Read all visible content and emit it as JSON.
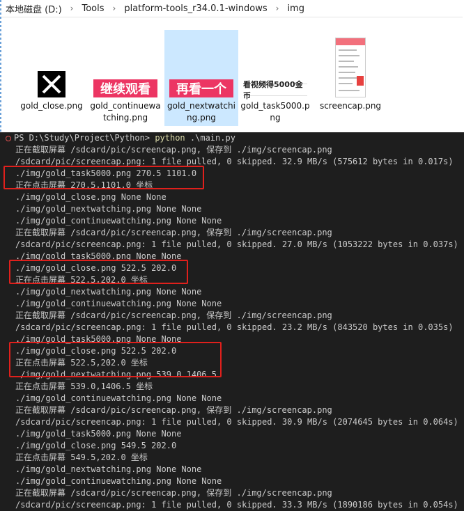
{
  "explorer": {
    "breadcrumb": [
      "本地磁盘 (D:)",
      "Tools",
      "platform-tools_r34.0.1-windows",
      "img"
    ],
    "separator": "›",
    "files": [
      {
        "name": "gold_close.png",
        "thumb": "close-x-icon"
      },
      {
        "name": "gold_continuewatching.png",
        "thumb": "banner",
        "banner_text": "继续观看"
      },
      {
        "name": "gold_nextwatching.png",
        "thumb": "banner",
        "banner_text": "再看一个"
      },
      {
        "name": "gold_task5000.png",
        "thumb": "banner",
        "banner_text": "看视频得5000金币"
      },
      {
        "name": "screencap.png",
        "thumb": "phone-screenshot"
      }
    ],
    "selected_file": "gold_nextwatching.png"
  },
  "terminal": {
    "prompt": "PS D:\\Study\\Project\\Python>",
    "command": "python",
    "command_args": ".\\main.py",
    "lines": [
      "正在截取屏幕 /sdcard/pic/screencap.png, 保存到 ./img/screencap.png",
      "/sdcard/pic/screencap.png: 1 file pulled, 0 skipped. 32.9 MB/s (575612 bytes in 0.017s)",
      "./img/gold_task5000.png 270.5 1101.0",
      "正在点击屏幕 270.5,1101.0 坐标",
      "./img/gold_close.png None None",
      "./img/gold_nextwatching.png None None",
      "./img/gold_continuewatching.png None None",
      "正在截取屏幕 /sdcard/pic/screencap.png, 保存到 ./img/screencap.png",
      "/sdcard/pic/screencap.png: 1 file pulled, 0 skipped. 27.0 MB/s (1053222 bytes in 0.037s)",
      "./img/gold_task5000.png None None",
      "./img/gold_close.png 522.5 202.0",
      "正在点击屏幕 522.5,202.0 坐标",
      "./img/gold_nextwatching.png None None",
      "./img/gold_continuewatching.png None None",
      "正在截取屏幕 /sdcard/pic/screencap.png, 保存到 ./img/screencap.png",
      "/sdcard/pic/screencap.png: 1 file pulled, 0 skipped. 23.2 MB/s (843520 bytes in 0.035s)",
      "./img/gold_task5000.png None None",
      "./img/gold_close.png 522.5 202.0",
      "正在点击屏幕 522.5,202.0 坐标",
      "./img/gold_nextwatching.png 539.0 1406.5",
      "正在点击屏幕 539.0,1406.5 坐标",
      "./img/gold_continuewatching.png None None",
      "正在截取屏幕 /sdcard/pic/screencap.png, 保存到 ./img/screencap.png",
      "/sdcard/pic/screencap.png: 1 file pulled, 0 skipped. 30.9 MB/s (2074645 bytes in 0.064s)",
      "./img/gold_task5000.png None None",
      "./img/gold_close.png 549.5 202.0",
      "正在点击屏幕 549.5,202.0 坐标",
      "./img/gold_nextwatching.png None None",
      "./img/gold_continuewatching.png None None",
      "正在截取屏幕 /sdcard/pic/screencap.png, 保存到 ./img/screencap.png",
      "/sdcard/pic/screencap.png: 1 file pulled, 0 skipped. 33.3 MB/s (1890186 bytes in 0.054s)"
    ],
    "highlight_color": "#e0201c"
  }
}
